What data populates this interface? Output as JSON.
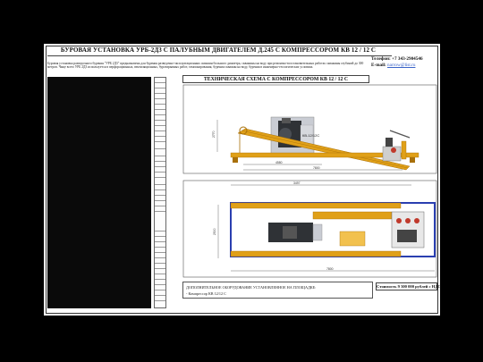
{
  "document": {
    "title": "БУРОВАЯ УСТАНОВКА УРБ-2Д3 С ПАЛУБНЫМ ДВИГАТЕЛЕМ Д.245 С КОМПРЕССОРОМ КВ 12 / 12 С",
    "description": "Буровая установка разведочного бурения \"УРБ 2Д3\" предназначена для бурения разведочно-эксплуатационных скважин большого диаметра, скважины на воду при ремонтно-восстановительных работах скважины глубиной до 300 метров. Чаще всего УРБ 2Д3 используется в перфорационных, вентиляционных, буровзрывных работ, тампонирования, бурения скважин на воду, бурения в инженерно-геологических условиях.",
    "contacts": {
      "phone_label": "Телефон:",
      "phone": "+7 343-2904546",
      "email_label": "E-mail:",
      "email": "narrow@list.ru"
    },
    "scheme_title": "ТЕХНИЧЕСКАЯ СХЕМА С КОМПРЕССОРОМ КВ 12 / 12 С",
    "compressor_label": "КВ-12/12С",
    "additional_equipment_title": "ДОПОЛНИТЕЛЬНОЕ ОБОРУДОВАНИЕ УСТАНОВЛЕННОЕ НА ПЛОЩАДКЕ:",
    "additional_equipment_item": "- Компрессор КВ 12/12 С",
    "price": "Стоимость 9 300 000 рублей с НДС",
    "dimensions": {
      "top_a": "4580",
      "top_b": "7800",
      "side_h": "2770",
      "bottom_a": "3497",
      "bottom_b": "7800",
      "side_w": "2500"
    }
  },
  "colors": {
    "mast": "#e0a018",
    "mast_dark": "#a8700a",
    "frame_blue": "#2a3fb0",
    "compressor_bg": "#c9ccd3",
    "engine": "#2f3236"
  }
}
